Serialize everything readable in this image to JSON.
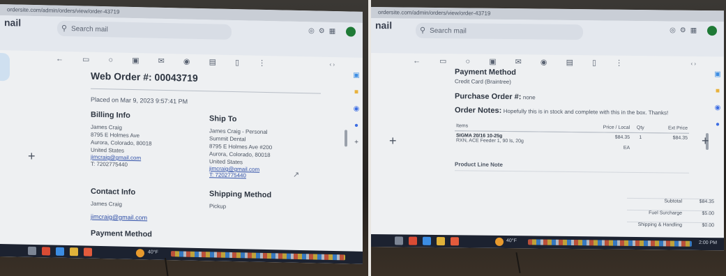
{
  "browser": {
    "url": "ordersite.com/admin/orders/view/order-43719"
  },
  "gmail": {
    "title": "nail",
    "search_placeholder": "Search mail",
    "icons": [
      "search-icon",
      "settings-icon",
      "apps-icon",
      "help-icon"
    ]
  },
  "left": {
    "order_heading": "Web Order #: 00043719",
    "placed": "Placed on Mar 9, 2023 9:57:41 PM",
    "billing": {
      "title": "Billing Info",
      "lines": [
        "James Craig",
        "8795 E Holmes Ave",
        "Aurora, Colorado, 80018",
        "United States"
      ],
      "email": "jimcraig@gmail.com",
      "phone": "T: 7202775440"
    },
    "shipto": {
      "title": "Ship To",
      "lines": [
        "James Craig - Personal",
        "Summit Dental",
        "8795 E Holmes Ave #200",
        "Aurora, Colorado, 80018",
        "United States"
      ],
      "email": "jimcraig@gmail.com",
      "phone": "T: 7202775440"
    },
    "contact": {
      "title": "Contact Info",
      "name": "James Craig",
      "email": "jimcraig@gmail.com"
    },
    "shipping_method": {
      "title": "Shipping Method",
      "value": "Pickup"
    },
    "payment_heading": "Payment Method",
    "tray": {
      "weather": "40°F"
    }
  },
  "right": {
    "payment": {
      "title": "Payment Method",
      "value": "Credit Card (Braintree)"
    },
    "po": {
      "title": "Purchase Order #:",
      "value": "none"
    },
    "notes": {
      "title": "Order Notes:",
      "value": "Hopefully this is in stock and complete with this in the box. Thanks!"
    },
    "table": {
      "headers": [
        "Items",
        "Price / Local",
        "Qty",
        "Ext Price"
      ],
      "rows": [
        {
          "sku": "SIGMA 20/16 10-25g",
          "desc": "RXN, ACE Feeder 1, 90 ls, 20g",
          "price": "$84.35",
          "qty": "1",
          "ext": "$84.35",
          "unit": "EA"
        }
      ]
    },
    "line_note": "Product Line Note",
    "totals": [
      {
        "label": "Subtotal",
        "value": "$84.35"
      },
      {
        "label": "Fuel Surcharge",
        "value": "$5.00"
      },
      {
        "label": "Shipping & Handling",
        "value": "$0.00"
      }
    ],
    "tray": {
      "weather": "40°F",
      "time": "2:00 PM"
    }
  }
}
